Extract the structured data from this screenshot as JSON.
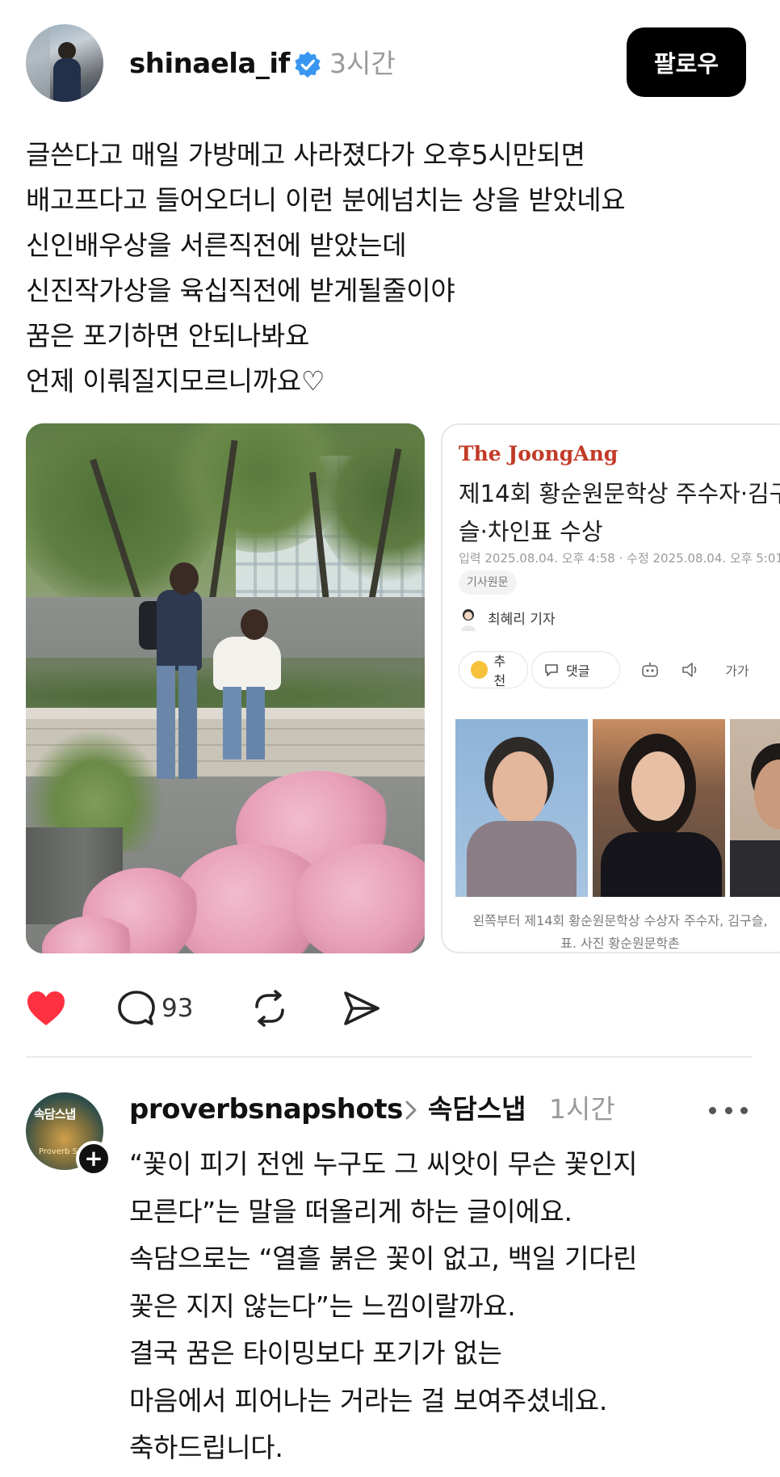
{
  "post": {
    "username": "shinaela_if",
    "time": "3시간",
    "follow_label": "팔로우",
    "text_lines": [
      "글쓴다고 매일 가방메고 사라졌다가 오후5시만되면",
      "배고프다고 들어오더니 이런 분에넘치는 상을 받았네요",
      "신인배우상을 서른직전에 받았는데",
      "신진작가상을 육십직전에 받게될줄이야",
      "꿈은 포기하면 안되나봐요",
      "언제 이뤄질지모르니까요♡"
    ]
  },
  "article": {
    "brand": "The JoongAng",
    "headline_lines": [
      "제14회 황순원문학상 주수자·김구",
      "슬·차인표 수상"
    ],
    "dates": "입력 2025.08.04. 오후 4:58 · 수정 2025.08.04. 오후 5:01",
    "tag": "기사원문",
    "reporter": "최혜리 기자",
    "recommend_label": "추천",
    "comment_label": "댓글",
    "font_size_label": "가가",
    "caption_lines": [
      "왼쪽부터 제14회 황순원문학상 수상자 주수자, 김구슬,",
      "표. 사진 황순원문학촌"
    ]
  },
  "actions": {
    "liked": true,
    "comment_count": "93"
  },
  "reply": {
    "avatar_text": "속담스냅",
    "avatar_subtext": "Proverb Snap",
    "username": "proverbsnapshots",
    "topic": "속담스냅",
    "time": "1시간",
    "text_lines": [
      "“꽃이 피기 전엔 누구도 그 씨앗이 무슨 꽃인지",
      "모른다”는 말을 떠올리게 하는 글이에요.",
      "속담으로는 “열흘 붉은 꽃이 없고, 백일 기다린",
      "꽃은 지지 않는다”는 느낌이랄까요.",
      "결국 꿈은 타이밍보다 포기가 없는",
      "마음에서 피어나는 거라는 걸 보여주셨네요.",
      "축하드립니다."
    ]
  },
  "colors": {
    "verified_blue": "#3897f0",
    "like_red": "#ff3040",
    "brand_red": "#c23b27",
    "muted_gray": "#9a9a9a"
  },
  "icons": {
    "verified": "verified-badge-icon",
    "like": "heart-icon",
    "comment": "comment-bubble-icon",
    "repost": "repost-icon",
    "share": "send-icon",
    "more": "more-dots-icon"
  }
}
